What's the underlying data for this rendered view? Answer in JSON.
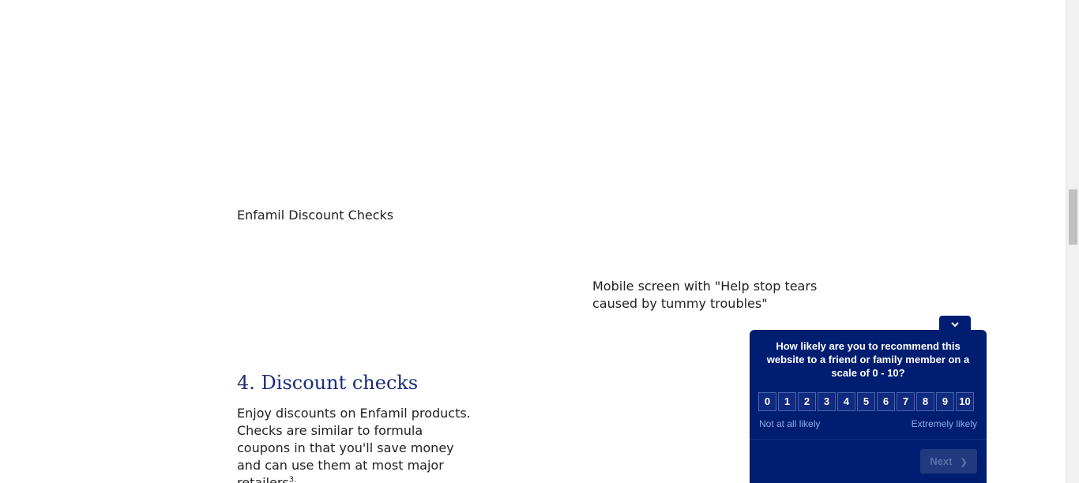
{
  "images": {
    "checks_alt": "Enfamil Discount Checks",
    "mobile_alt": "Mobile screen with \"Help stop tears caused by tummy troubles\""
  },
  "section": {
    "heading": "4. Discount checks",
    "body": "Enjoy discounts on Enfamil products. Checks are similar to formula coupons in that you'll save money and can use them at most major retailers",
    "footnote": "3."
  },
  "survey": {
    "toggle_icon": "chevron-down-icon",
    "question": "How likely are you to recommend this website to a friend or family member on a scale of 0 - 10?",
    "scale": [
      "0",
      "1",
      "2",
      "3",
      "4",
      "5",
      "6",
      "7",
      "8",
      "9",
      "10"
    ],
    "low_label": "Not at all likely",
    "high_label": "Extremely likely",
    "next_label": "Next",
    "colors": {
      "panel": "#001e71",
      "label": "#8fa8e8",
      "heading": "#1a2d7a"
    }
  }
}
